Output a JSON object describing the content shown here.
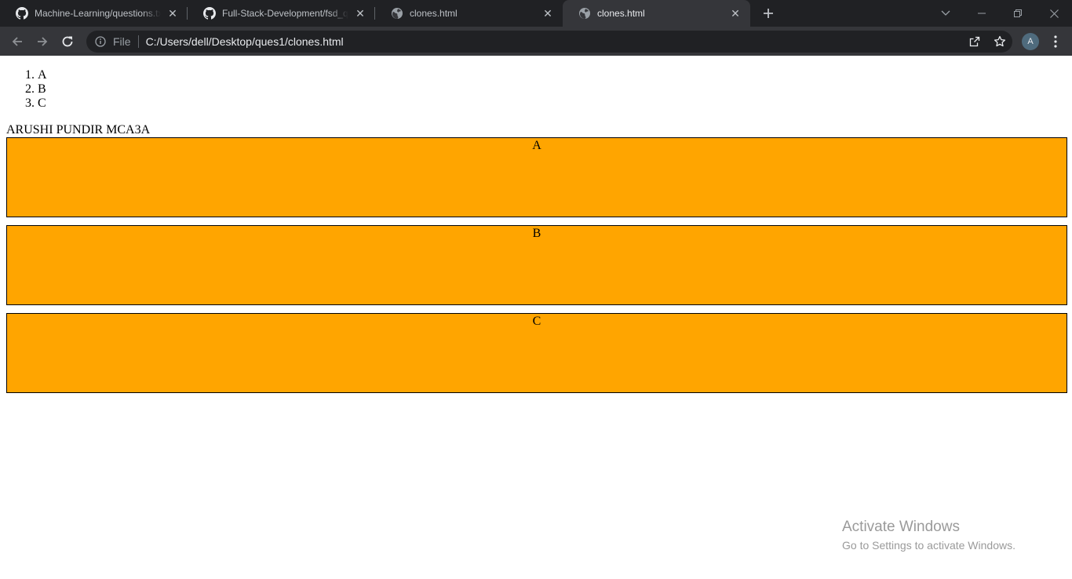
{
  "browser": {
    "tabs": [
      {
        "title": "Machine-Learning/questions.txt at",
        "favicon": "github-icon",
        "active": false
      },
      {
        "title": "Full-Stack-Development/fsd_ques",
        "favicon": "github-icon",
        "active": false
      },
      {
        "title": "clones.html",
        "favicon": "globe-icon",
        "active": false
      },
      {
        "title": "clones.html",
        "favicon": "globe-icon",
        "active": true
      }
    ],
    "omnibox": {
      "scheme": "File",
      "url": "C:/Users/dell/Desktop/ques1/clones.html"
    },
    "profile_initial": "A"
  },
  "page": {
    "ordered_list": [
      "A",
      "B",
      "C"
    ],
    "author": "ARUSHI PUNDIR MCA3A",
    "boxes": [
      "A",
      "B",
      "C"
    ],
    "box_color": "#ffa500"
  },
  "watermark": {
    "line1": "Activate Windows",
    "line2": "Go to Settings to activate Windows."
  }
}
